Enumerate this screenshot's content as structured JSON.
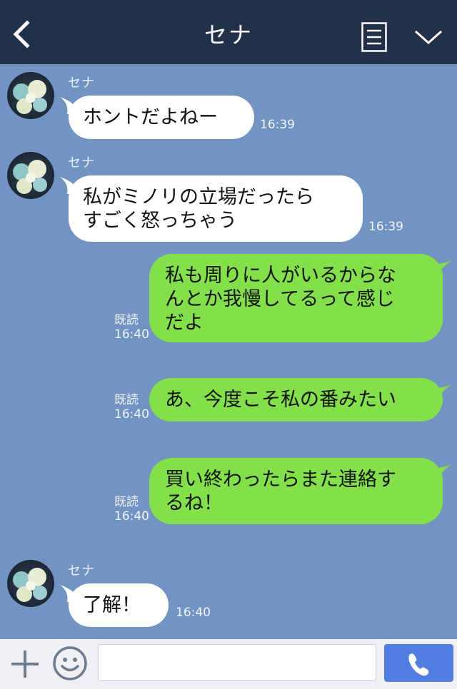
{
  "header": {
    "title": "セナ",
    "back_icon": "chevron-left-icon",
    "menu_icon": "menu-list-icon",
    "collapse_icon": "chevron-down-icon"
  },
  "messages": [
    {
      "direction": "in",
      "sender": "セナ",
      "text": "ホントだよねー",
      "time": "16:39"
    },
    {
      "direction": "in",
      "sender": "セナ",
      "text": "私がミノリの立場だったら\nすごく怒っちゃう",
      "time": "16:39"
    },
    {
      "direction": "out",
      "text": "私も周りに人がいるからな\nんとか我慢してるって感じ\nだよ",
      "read": "既読",
      "time": "16:40"
    },
    {
      "direction": "out",
      "text": "あ、今度こそ私の番みたい",
      "read": "既読",
      "time": "16:40"
    },
    {
      "direction": "out",
      "text": "買い終わったらまた連絡す\nるね！",
      "read": "既読",
      "time": "16:40"
    },
    {
      "direction": "in",
      "sender": "セナ",
      "text": "了解！",
      "time": "16:40"
    }
  ],
  "footer": {
    "input_placeholder": "",
    "plus_icon": "plus-icon",
    "emoji_icon": "emoji-icon",
    "call_icon": "phone-icon"
  },
  "colors": {
    "background": "#7294c3",
    "header": "#233049",
    "incoming_bubble": "#ffffff",
    "outgoing_bubble": "#84e04a",
    "call_button": "#4f7ee0"
  }
}
